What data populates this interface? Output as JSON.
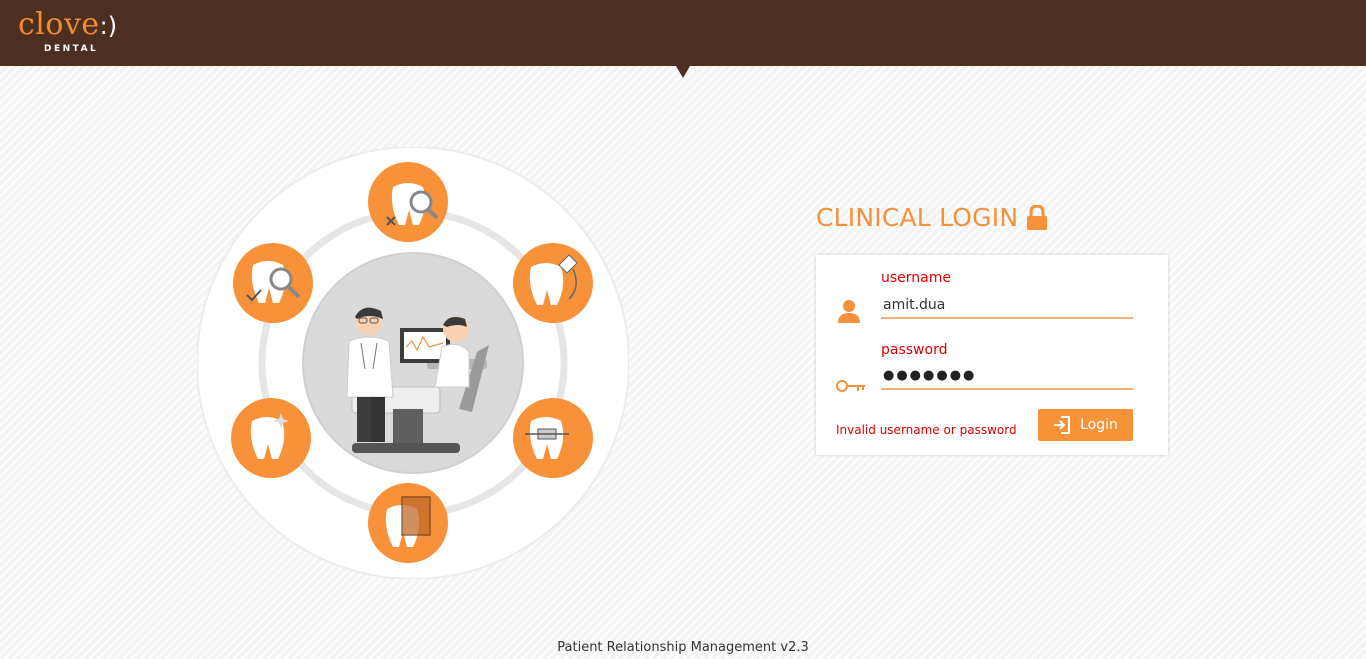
{
  "header": {
    "logo_word": "clove",
    "logo_smile": ":)",
    "logo_sub": "DENTAL"
  },
  "login": {
    "title": "CLINICAL LOGIN",
    "username_label": "username",
    "username_value": "amit.dua",
    "password_label": "password",
    "password_mask": "●●●●●●●",
    "error": "Invalid username or password",
    "button_label": "Login"
  },
  "footer": {
    "text": "Patient Relationship Management v2.3"
  },
  "colors": {
    "brand_brown": "#4d2f22",
    "accent_orange": "#f5913a",
    "error_red": "#e00000"
  }
}
